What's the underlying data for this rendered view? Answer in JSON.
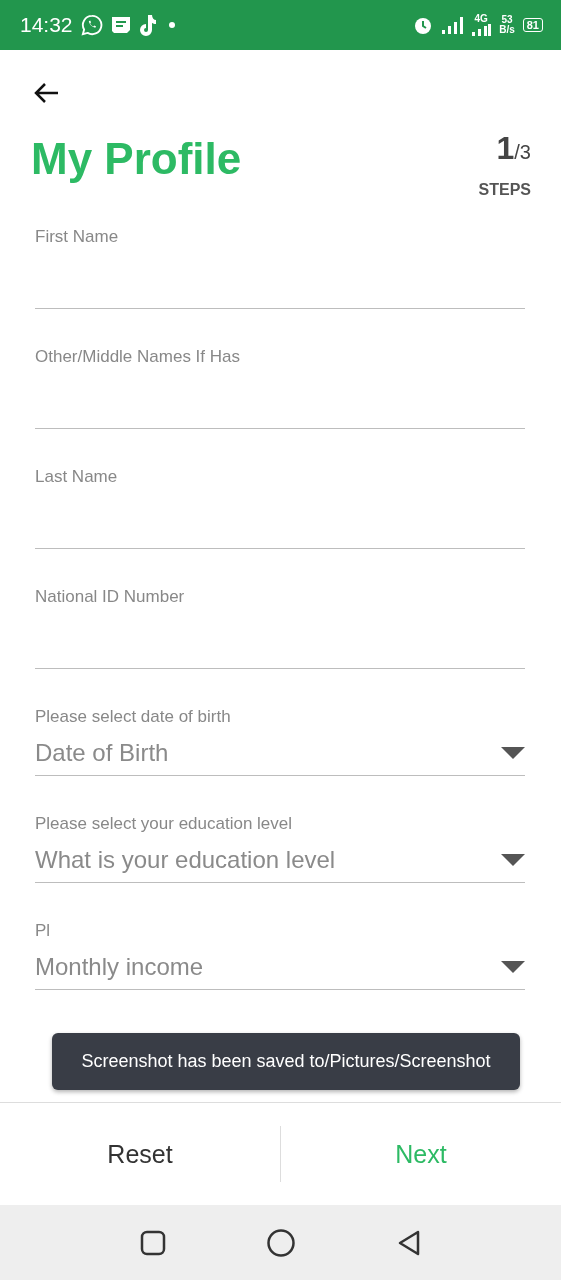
{
  "status_bar": {
    "time": "14:32",
    "network": "4G",
    "speed_value": "53",
    "speed_unit": "B/s",
    "battery": "81"
  },
  "header": {
    "title": "My Profile",
    "step_current": "1",
    "step_total": "/3",
    "step_label": "STEPS"
  },
  "fields": [
    {
      "kind": "text",
      "label": "First Name"
    },
    {
      "kind": "text",
      "label": "Other/Middle Names If Has"
    },
    {
      "kind": "text",
      "label": "Last Name"
    },
    {
      "kind": "text",
      "label": "National ID Number"
    },
    {
      "kind": "select",
      "label": "Please select date of birth",
      "placeholder": "Date of Birth"
    },
    {
      "kind": "select",
      "label": "Please select your education level",
      "placeholder": "What is your education level"
    },
    {
      "kind": "select",
      "label": "Pl",
      "placeholder": "Monthly income"
    }
  ],
  "toast": "Screenshot has been saved to/Pictures/Screenshot",
  "footer": {
    "reset": "Reset",
    "next": "Next"
  }
}
